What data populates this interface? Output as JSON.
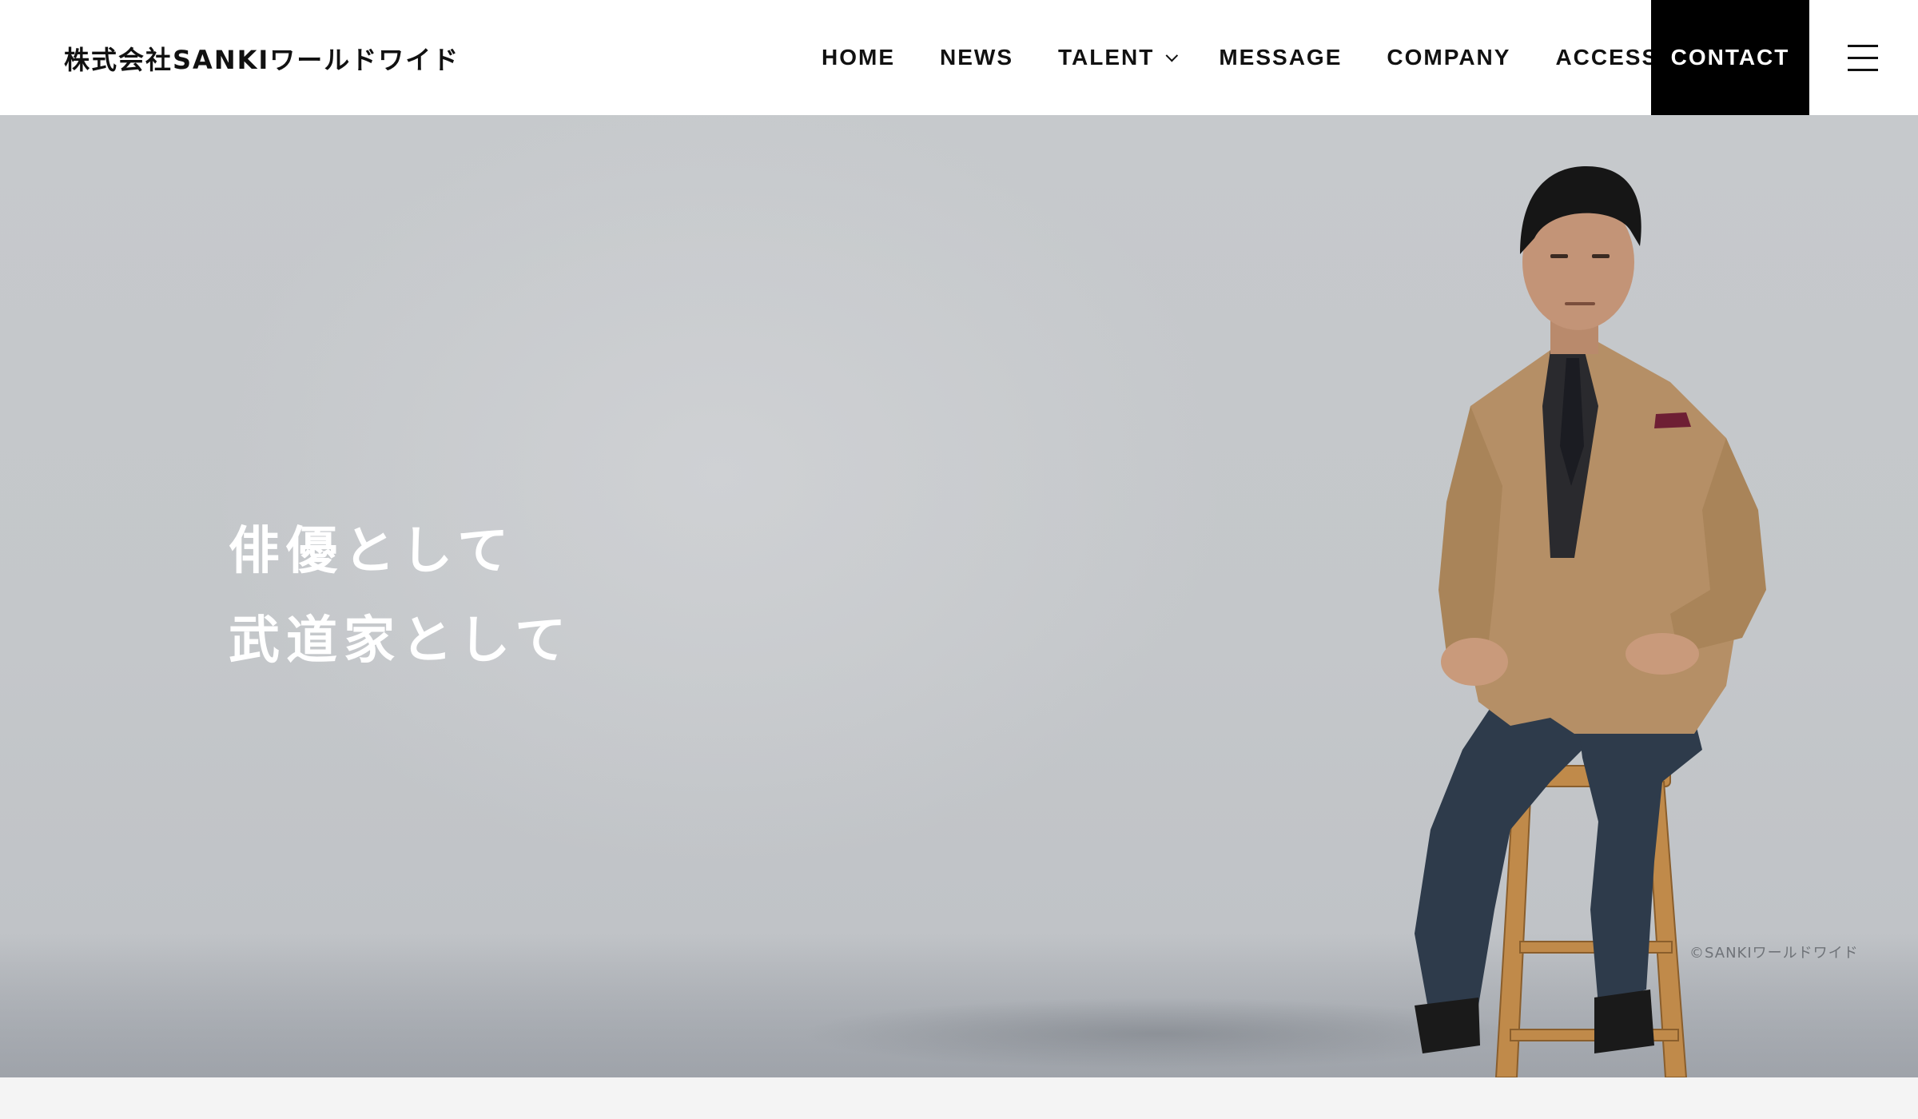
{
  "header": {
    "logo_text": "株式会社SANKIワールドワイド",
    "nav": {
      "home": "HOME",
      "news": "NEWS",
      "talent": "TALENT",
      "message": "MESSAGE",
      "company": "COMPANY",
      "access": "ACCESS",
      "contact": "CONTACT"
    },
    "menu_icon": "hamburger-icon"
  },
  "hero": {
    "tagline_line1": "俳優として",
    "tagline_line2": "武道家として",
    "photo_credit": "©SANKIワールドワイド"
  },
  "colors": {
    "header_bg": "#ffffff",
    "contact_bg": "#000000",
    "hero_bg": "#c4c7ca",
    "jacket": "#b58f66",
    "jeans": "#2e3b4b"
  }
}
